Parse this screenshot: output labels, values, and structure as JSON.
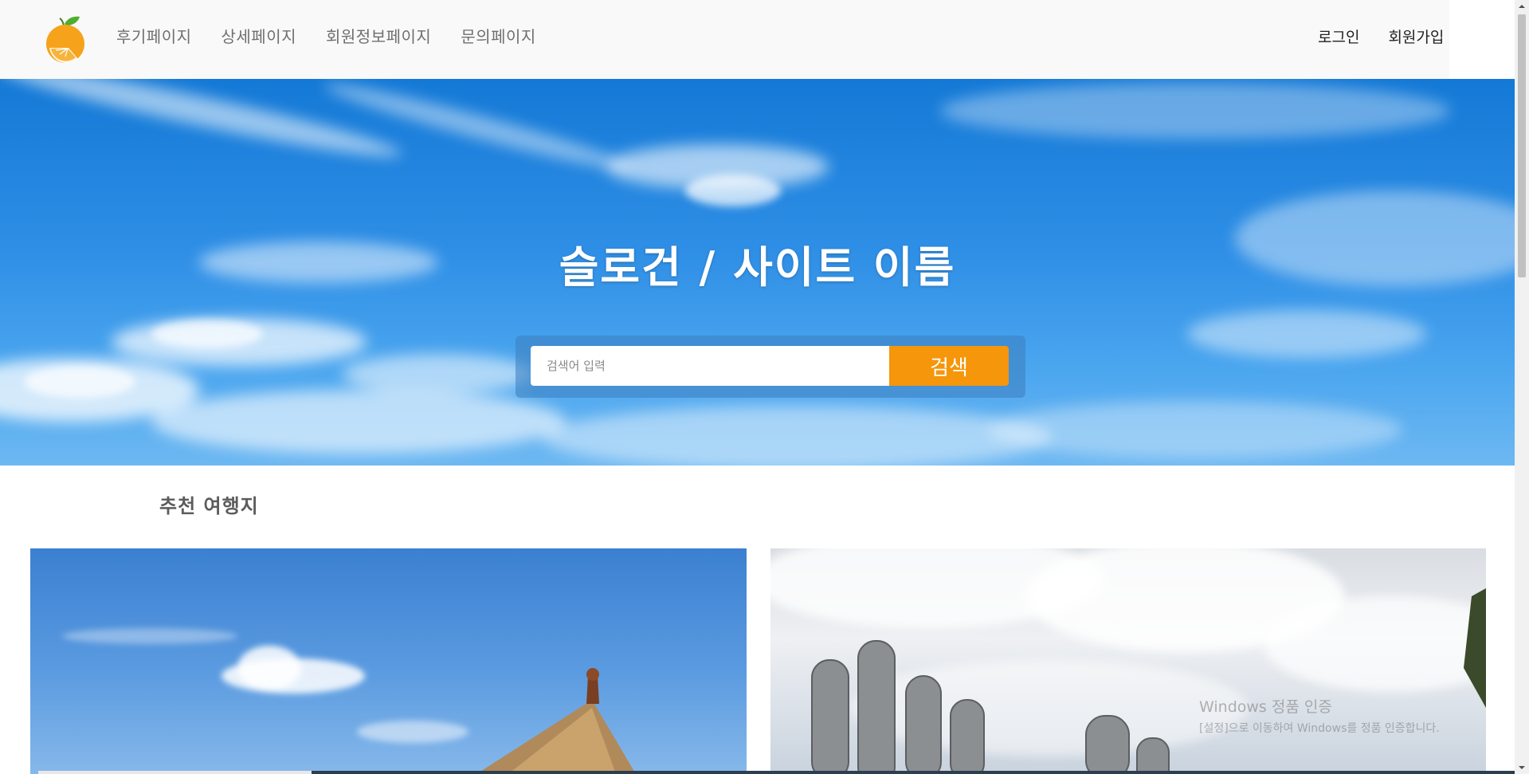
{
  "header": {
    "logo_icon": "orange-fruit-icon",
    "nav": [
      {
        "label": "후기페이지"
      },
      {
        "label": "상세페이지"
      },
      {
        "label": "회원정보페이지"
      },
      {
        "label": "문의페이지"
      }
    ],
    "auth": {
      "login": "로그인",
      "signup": "회원가입"
    }
  },
  "hero": {
    "title": "슬로건 / 사이트 이름",
    "search_placeholder": "검색어 입력",
    "search_button": "검색"
  },
  "recommended": {
    "title": "추천 여행지"
  },
  "watermark": {
    "line1": "Windows 정품 인증",
    "line2": "[설정]으로 이동하여 Windows를 정품 인증합니다."
  },
  "colors": {
    "accent": "#f6960a",
    "hero_sky": "#2f8fe6",
    "header_bg": "#f9f9f9"
  }
}
